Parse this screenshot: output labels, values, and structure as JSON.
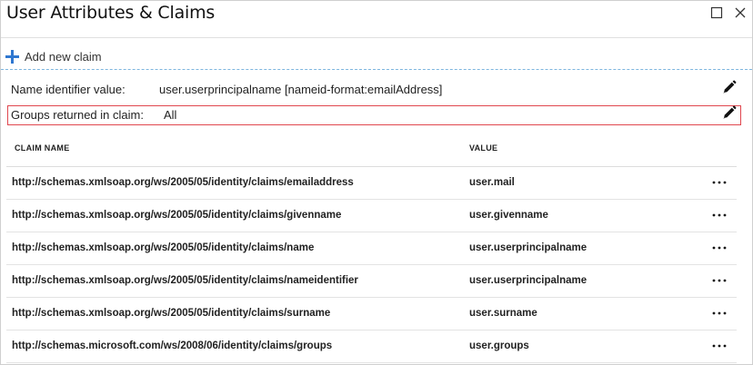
{
  "window": {
    "title": "User Attributes & Claims"
  },
  "toolbar": {
    "add_claim_label": "Add new claim"
  },
  "name_identifier": {
    "label": "Name identifier value:",
    "value": "user.userprincipalname [nameid-format:emailAddress]"
  },
  "groups_claim": {
    "label": "Groups returned in claim:",
    "value": "All"
  },
  "table": {
    "headers": {
      "claim_name": "CLAIM NAME",
      "value": "VALUE"
    },
    "rows": [
      {
        "name": "http://schemas.xmlsoap.org/ws/2005/05/identity/claims/emailaddress",
        "value": "user.mail"
      },
      {
        "name": "http://schemas.xmlsoap.org/ws/2005/05/identity/claims/givenname",
        "value": "user.givenname"
      },
      {
        "name": "http://schemas.xmlsoap.org/ws/2005/05/identity/claims/name",
        "value": "user.userprincipalname"
      },
      {
        "name": "http://schemas.xmlsoap.org/ws/2005/05/identity/claims/nameidentifier",
        "value": "user.userprincipalname"
      },
      {
        "name": "http://schemas.xmlsoap.org/ws/2005/05/identity/claims/surname",
        "value": "user.surname"
      },
      {
        "name": "http://schemas.microsoft.com/ws/2008/06/identity/claims/groups",
        "value": "user.groups"
      }
    ]
  },
  "icons": {
    "maximize": "maximize-icon",
    "close": "close-icon",
    "add": "plus-icon",
    "edit": "pencil-icon",
    "more": "ellipsis-icon"
  },
  "colors": {
    "accent_blue": "#2f77d0",
    "highlight_border": "#e0474f",
    "toolbar_divider": "#7db6df"
  }
}
